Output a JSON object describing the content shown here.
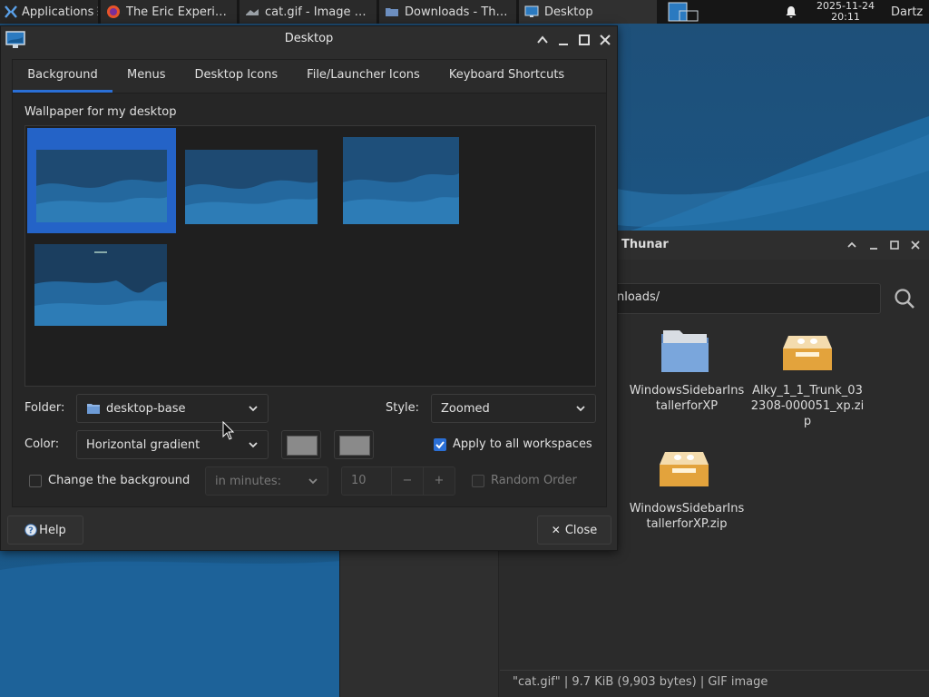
{
  "panel": {
    "applications": "Applications",
    "tasks": [
      {
        "label": "The Eric Experim...",
        "icon": "firefox-icon"
      },
      {
        "label": "cat.gif - Image V...",
        "icon": "image-viewer-icon"
      },
      {
        "label": "Downloads - Thu...",
        "icon": "folder-icon"
      },
      {
        "label": "Desktop",
        "icon": "desktop-settings-icon"
      }
    ],
    "date": "2025-11-24",
    "time": "20:11",
    "user": "Dartz"
  },
  "thunar": {
    "title": "Thunar",
    "location": "nloads/",
    "files": [
      {
        "name": "WindowsSidebarInstallerforXP",
        "lines": [
          "WindowsSidebarIns",
          "tallerforXP"
        ],
        "icon": "folder-icon"
      },
      {
        "name": "Alky_1_1_Trunk_032308-000051_xp.zip",
        "lines": [
          "Alky_1_1_Trunk_03",
          "2308-000051_xp.zi",
          "p"
        ],
        "icon": "archive-icon"
      },
      {
        "name": "WindowsSidebarInstallerforXP.zip",
        "lines": [
          "WindowsSidebarIns",
          "tallerforXP.zip"
        ],
        "icon": "archive-icon"
      }
    ],
    "status": "\"cat.gif\"  |  9.7 KiB (9,903 bytes)  |  GIF image"
  },
  "dialog": {
    "title": "Desktop",
    "tabs": [
      "Background",
      "Menus",
      "Desktop Icons",
      "File/Launcher Icons",
      "Keyboard Shortcuts"
    ],
    "active_tab": "Background",
    "wallpaper_label": "Wallpaper for my desktop",
    "folder_label": "Folder:",
    "folder_value": "desktop-base",
    "style_label": "Style:",
    "style_value": "Zoomed",
    "color_label": "Color:",
    "color_value": "Horizontal gradient",
    "apply_all": "Apply to all workspaces",
    "apply_all_checked": true,
    "change_bg": "Change the background",
    "change_bg_checked": false,
    "interval_unit": "in minutes:",
    "interval_value": "10",
    "random_order": "Random Order",
    "help": "Help",
    "close": "Close",
    "accent": "#2a6fd6"
  }
}
